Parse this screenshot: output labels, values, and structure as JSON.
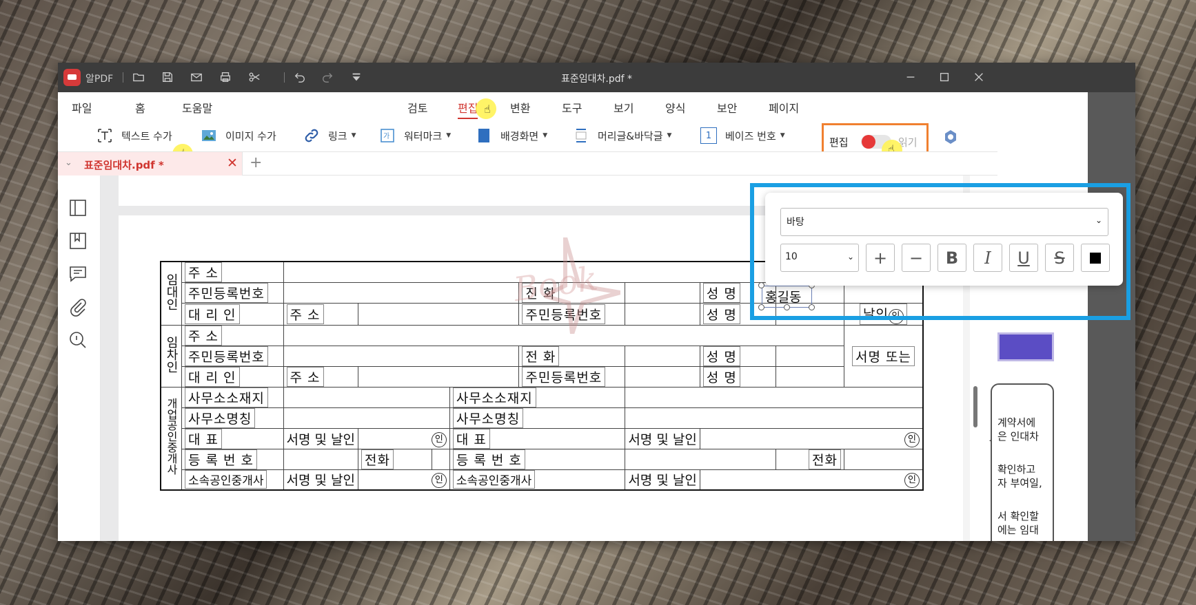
{
  "app": {
    "name": "알PDF",
    "document_title": "표준임대차.pdf *"
  },
  "menu": {
    "left": [
      "파일",
      "홈",
      "도움말"
    ],
    "center": [
      "검토",
      "편집",
      "변환",
      "도구",
      "보기",
      "양식",
      "보안",
      "페이지"
    ],
    "active": "편집"
  },
  "toolbar": {
    "text_add": "텍스트 수가",
    "image_add": "이미지 수가",
    "link": "링크",
    "watermark": "워터마크",
    "background": "배경화면",
    "header_footer": "머리글&바닥글",
    "page_number": "베이즈 번호",
    "page_number_icon": "1",
    "edit_label": "편집",
    "read_label": "읽기"
  },
  "tabs": [
    {
      "label": "표준임대차.pdf *"
    }
  ],
  "format_panel": {
    "font": "바탕",
    "size": "10",
    "bold": "B",
    "italic": "I",
    "underline": "U",
    "strike": "S",
    "color": "#000000"
  },
  "form": {
    "seller_group": "임대인",
    "buyer_group": "임차인",
    "agent_group": "개업공인중개사",
    "address": "주 소",
    "resident_no": "주민등록번호",
    "agent_rep": "대 리 인",
    "addr_short": "주 소",
    "phone": "전 화",
    "phone_alt": "진 화",
    "name": "성 명",
    "sign_or": "서명 또는",
    "seal_label": "날인",
    "seal_char": "인",
    "office_loc": "사무소소재지",
    "office_name": "사무소명칭",
    "rep": "대 표",
    "sign_seal": "서명 및 날인",
    "reg_no": "등 록 번 호",
    "tel": "전화",
    "affiliated": "소속공인중개사",
    "selected_name": "홍길동"
  },
  "right_page": {
    "lines": [
      "계약서에",
      "은 인대차",
      "확인하고",
      "자 부여일,",
      "서 확인할",
      "에는 임대"
    ]
  },
  "watermark": "Book"
}
